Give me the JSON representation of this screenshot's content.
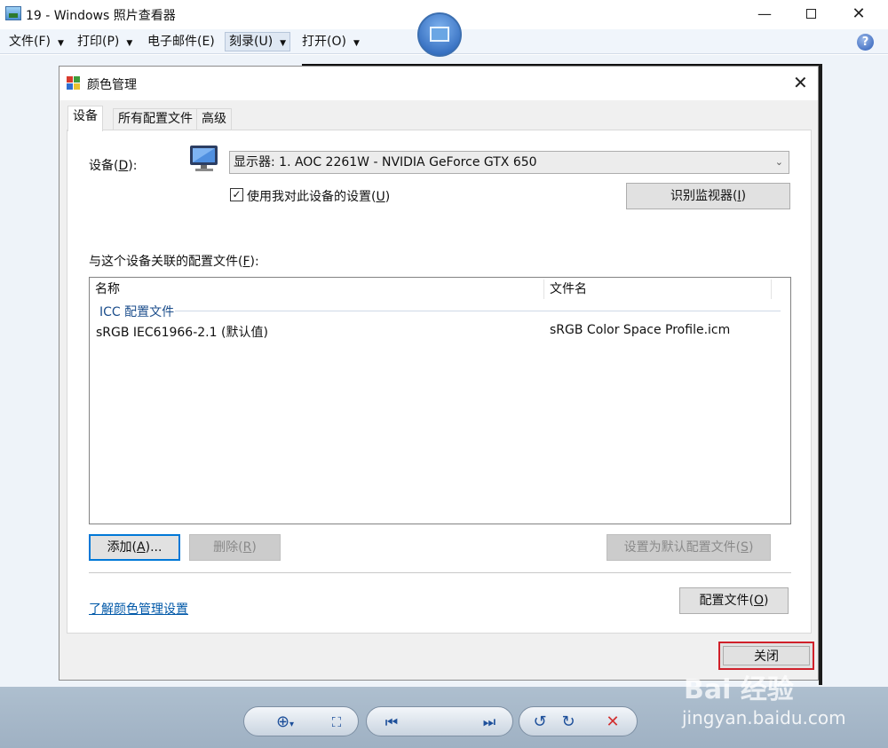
{
  "window": {
    "title": "19 - Windows 照片查看器",
    "min_glyph": "—",
    "close_glyph": "✕"
  },
  "menubar": {
    "items": [
      {
        "label": "文件(F)"
      },
      {
        "label": "打印(P)"
      },
      {
        "label": "电子邮件(E)"
      },
      {
        "label": "刻录(U)"
      },
      {
        "label": "打开(O)"
      }
    ],
    "arrow": "▼",
    "help": "?"
  },
  "dialog": {
    "title": "颜色管理",
    "close_glyph": "✕",
    "tabs": [
      {
        "label": "设备"
      },
      {
        "label": "所有配置文件"
      },
      {
        "label": "高级"
      }
    ],
    "device_label_pre": "设备(",
    "device_label_key": "D",
    "device_label_post": "):",
    "device_value": "显示器: 1. AOC 2261W - NVIDIA GeForce GTX 650",
    "combo_chevron": "⌄",
    "use_settings_pre": "使用我对此设备的设置(",
    "use_settings_key": "U",
    "use_settings_post": ")",
    "use_settings_checked": "✓",
    "identify_pre": "识别监视器(",
    "identify_key": "I",
    "identify_post": ")",
    "profiles_label_pre": "与这个设备关联的配置文件(",
    "profiles_label_key": "F",
    "profiles_label_post": "):",
    "list": {
      "columns": [
        "名称",
        "文件名"
      ],
      "group": "ICC 配置文件",
      "rows": [
        {
          "name": "sRGB IEC61966-2.1 (默认值)",
          "file": "sRGB Color Space Profile.icm"
        }
      ]
    },
    "add_pre": "添加(",
    "add_key": "A",
    "add_post": ")...",
    "remove_pre": "删除(",
    "remove_key": "R",
    "remove_post": ")",
    "set_default_pre": "设置为默认配置文件(",
    "set_default_key": "S",
    "set_default_post": ")",
    "profiles_btn_pre": "配置文件(",
    "profiles_btn_key": "O",
    "profiles_btn_post": ")",
    "learn_link": "了解颜色管理设置",
    "close_label": "关闭"
  },
  "toolbar": {
    "zoom": "⊕",
    "zoom_arrow": "▾",
    "fit": "⛶",
    "prev": "⏮",
    "next": "⏭",
    "rotate_ccw": "↺",
    "rotate_cw": "↻",
    "delete": "✕"
  },
  "watermark": {
    "logo": "Bai 经验",
    "url": "jingyan.baidu.com"
  },
  "colors": {
    "accent": "#0078d7",
    "highlight_border": "#d0202a",
    "link": "#0058a8",
    "delete": "#d23030"
  }
}
